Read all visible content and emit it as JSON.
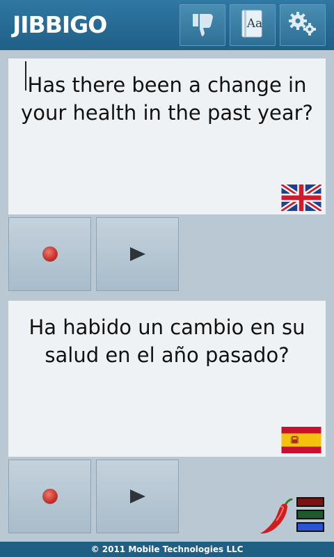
{
  "app": {
    "logo_text": "JIBBIGO"
  },
  "toolbar": {
    "feedback_icon": "thumbs-down-icon",
    "dictionary_icon": "dictionary-icon",
    "dictionary_glyph": "Aa",
    "settings_icon": "gears-icon"
  },
  "source_panel": {
    "text": "Has there been a change in your health in the past year?",
    "language_flag": "uk-flag-icon"
  },
  "target_panel": {
    "text": "Ha habido un cambio en su salud en el año pasado?",
    "language_flag": "spain-flag-icon"
  },
  "controls": {
    "record_icon": "record-icon",
    "play_icon": "play-icon"
  },
  "indicator": {
    "mascot_icon": "chili-pepper-icon",
    "colors": [
      "#7a1414",
      "#1f5a2a",
      "#2b53d6"
    ]
  },
  "footer": {
    "copyright": "© 2011 Mobile Technologies LLC"
  },
  "colors": {
    "header_bg": "#2f78a3",
    "panel_bg": "#eff2f5",
    "workspace_bg": "#b9c8d2"
  }
}
